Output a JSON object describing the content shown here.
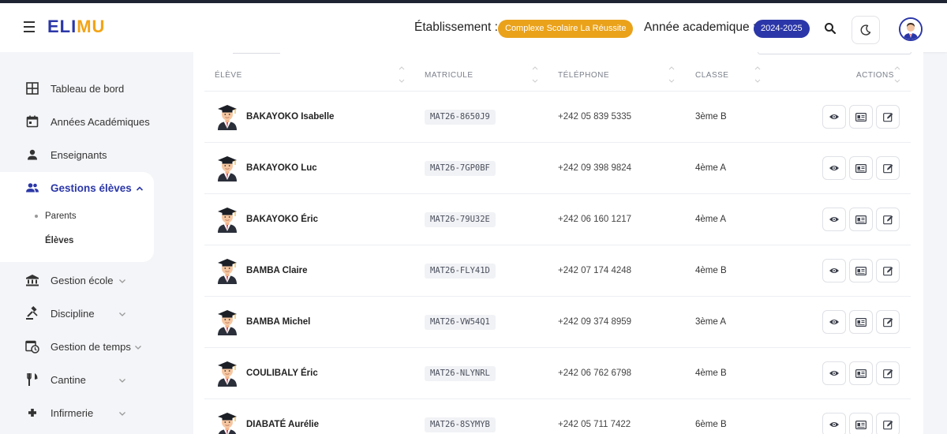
{
  "app": {
    "logo_part1": "ELI",
    "logo_part2": "MU"
  },
  "header": {
    "etablissement_label": "Établissement :",
    "etablissement_value": "Complexe Scolaire La Réussite",
    "annee_label": "Année academique :",
    "annee_value": "2024-2025",
    "icons": [
      "menu-icon",
      "search-icon",
      "moon-icon",
      "user-avatar"
    ]
  },
  "sidebar": {
    "items": [
      {
        "label": "Tableau de bord",
        "icon": "dashboard-icon"
      },
      {
        "label": "Années Académiques",
        "icon": "calendar-icon"
      },
      {
        "label": "Enseignants",
        "icon": "person-icon"
      },
      {
        "label": "Gestions élèves",
        "icon": "group-icon",
        "active": true,
        "expanded": true
      },
      {
        "label": "Gestion école",
        "icon": "bank-icon"
      },
      {
        "label": "Discipline",
        "icon": "gavel-icon"
      },
      {
        "label": "Gestion de temps",
        "icon": "schedule-icon"
      },
      {
        "label": "Cantine",
        "icon": "restaurant-icon"
      },
      {
        "label": "Infirmerie",
        "icon": "plus-icon"
      }
    ],
    "subitems": [
      {
        "label": "Parents"
      },
      {
        "label": "Élèves",
        "active": true
      }
    ]
  },
  "table": {
    "headers": {
      "eleve": "ÉLÈVE",
      "matricule": "MATRICULE",
      "telephone": "TÉLÉPHONE",
      "classe": "CLASSE",
      "actions": "ACTIONS"
    },
    "rows": [
      {
        "name": "BAKAYOKO Isabelle",
        "matricule": "MAT26-8650J9",
        "telephone": "+242 05 839 5335",
        "classe": "3ème B"
      },
      {
        "name": "BAKAYOKO Luc",
        "matricule": "MAT26-7GP0BF",
        "telephone": "+242 09 398 9824",
        "classe": "4ème A"
      },
      {
        "name": "BAKAYOKO Éric",
        "matricule": "MAT26-79U32E",
        "telephone": "+242 06 160 1217",
        "classe": "4ème A"
      },
      {
        "name": "BAMBA Claire",
        "matricule": "MAT26-FLY41D",
        "telephone": "+242 07 174 4248",
        "classe": "4ème B"
      },
      {
        "name": "BAMBA Michel",
        "matricule": "MAT26-VW54Q1",
        "telephone": "+242 09 374 8959",
        "classe": "3ème A"
      },
      {
        "name": "COULIBALY Éric",
        "matricule": "MAT26-NLYNRL",
        "telephone": "+242 06 762 6798",
        "classe": "4ème B"
      },
      {
        "name": "DIABATÉ Aurélie",
        "matricule": "MAT26-8SYMYB",
        "telephone": "+242 05 711 7422",
        "classe": "6ème B"
      }
    ],
    "action_icons": [
      "eye-icon",
      "id-card-icon",
      "edit-icon"
    ]
  },
  "colors": {
    "brand_blue": "#2b37a8",
    "brand_orange": "#f3a417",
    "badge_orange": "#eaa21b"
  }
}
